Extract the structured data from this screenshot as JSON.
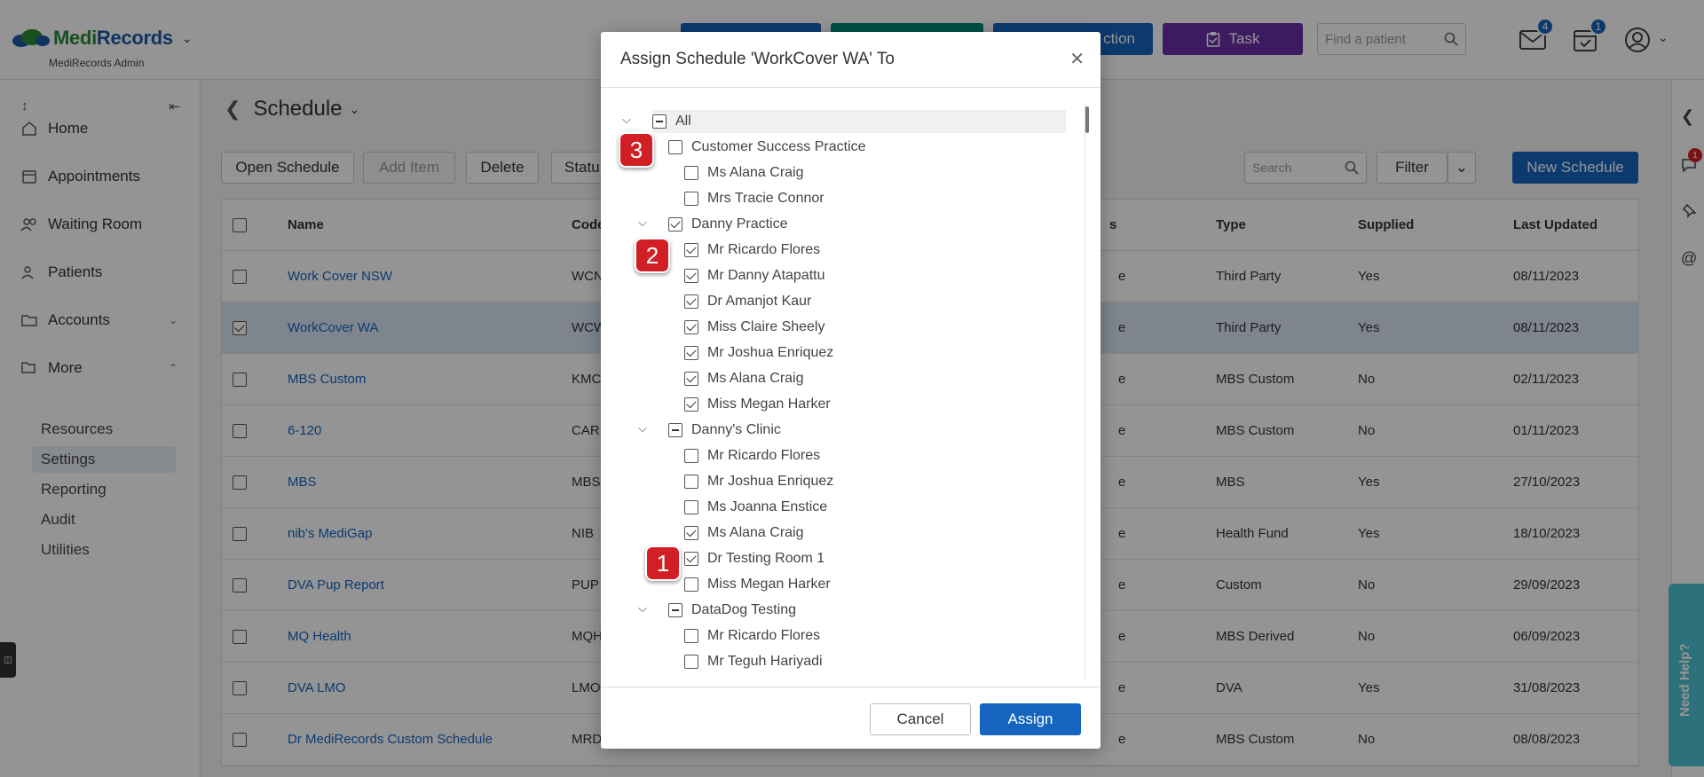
{
  "header": {
    "brand_medi": "Medi",
    "brand_records": "Records",
    "subtitle": "MediRecords Admin",
    "btn3_label": "ction",
    "task_label": "Task",
    "find_placeholder": "Find a patient",
    "messages_badge": "4",
    "tasks_badge": "1"
  },
  "sidebar": {
    "items": [
      {
        "label": "Home"
      },
      {
        "label": "Appointments"
      },
      {
        "label": "Waiting Room"
      },
      {
        "label": "Patients"
      },
      {
        "label": "Accounts"
      },
      {
        "label": "More"
      }
    ],
    "sub_items": [
      {
        "label": "Resources"
      },
      {
        "label": "Settings"
      },
      {
        "label": "Reporting"
      },
      {
        "label": "Audit"
      },
      {
        "label": "Utilities"
      }
    ]
  },
  "page": {
    "title": "Schedule",
    "toolbar": {
      "open": "Open Schedule",
      "add": "Add Item",
      "delete": "Delete",
      "status": "Statu",
      "search_placeholder": "Search",
      "filter": "Filter",
      "new": "New Schedule"
    },
    "columns": {
      "name": "Name",
      "code": "Code",
      "status": "s",
      "type": "Type",
      "supplied": "Supplied",
      "updated": "Last Updated"
    },
    "rows": [
      {
        "name": "Work Cover NSW",
        "code": "WCN",
        "status": "e",
        "type": "Third Party",
        "supplied": "Yes",
        "updated": "08/11/2023",
        "selected": false
      },
      {
        "name": "WorkCover WA",
        "code": "WCW",
        "status": "e",
        "type": "Third Party",
        "supplied": "Yes",
        "updated": "08/11/2023",
        "selected": true
      },
      {
        "name": "MBS Custom",
        "code": "KMC",
        "status": "e",
        "type": "MBS Custom",
        "supplied": "No",
        "updated": "02/11/2023",
        "selected": false
      },
      {
        "name": "6-120",
        "code": "CAR",
        "status": "e",
        "type": "MBS Custom",
        "supplied": "No",
        "updated": "01/11/2023",
        "selected": false
      },
      {
        "name": "MBS",
        "code": "MBS",
        "status": "e",
        "type": "MBS",
        "supplied": "Yes",
        "updated": "27/10/2023",
        "selected": false
      },
      {
        "name": "nib's MediGap",
        "code": "NIB",
        "status": "e",
        "type": "Health Fund",
        "supplied": "Yes",
        "updated": "18/10/2023",
        "selected": false
      },
      {
        "name": "DVA Pup Report",
        "code": "PUP",
        "status": "e",
        "type": "Custom",
        "supplied": "No",
        "updated": "29/09/2023",
        "selected": false
      },
      {
        "name": "MQ Health",
        "code": "MQH",
        "status": "e",
        "type": "MBS Derived",
        "supplied": "No",
        "updated": "06/09/2023",
        "selected": false
      },
      {
        "name": "DVA LMO",
        "code": "LMO",
        "status": "e",
        "type": "DVA",
        "supplied": "Yes",
        "updated": "31/08/2023",
        "selected": false
      },
      {
        "name": "Dr MediRecords Custom Schedule",
        "code": "MRD",
        "status": "e",
        "type": "MBS Custom",
        "supplied": "No",
        "updated": "08/08/2023",
        "selected": false
      }
    ]
  },
  "right_rail": {
    "chat_badge": "1",
    "need_help": "Need Help?"
  },
  "modal": {
    "title": "Assign Schedule 'WorkCover WA' To",
    "cancel": "Cancel",
    "assign": "Assign",
    "tree": [
      {
        "label": "All",
        "level": 0,
        "state": "ind",
        "expandable": true
      },
      {
        "label": "Customer Success Practice",
        "level": 1,
        "state": "off",
        "expandable": false
      },
      {
        "label": "Ms Alana Craig",
        "level": 2,
        "state": "off"
      },
      {
        "label": "Mrs Tracie Connor",
        "level": 2,
        "state": "off"
      },
      {
        "label": "Danny Practice",
        "level": 1,
        "state": "on",
        "expandable": true
      },
      {
        "label": "Mr Ricardo Flores",
        "level": 2,
        "state": "on"
      },
      {
        "label": "Mr Danny Atapattu",
        "level": 2,
        "state": "on"
      },
      {
        "label": "Dr Amanjot Kaur",
        "level": 2,
        "state": "on"
      },
      {
        "label": "Miss Claire Sheely",
        "level": 2,
        "state": "on"
      },
      {
        "label": "Mr Joshua Enriquez",
        "level": 2,
        "state": "on"
      },
      {
        "label": "Ms Alana Craig",
        "level": 2,
        "state": "on"
      },
      {
        "label": "Miss Megan Harker",
        "level": 2,
        "state": "on"
      },
      {
        "label": "Danny's Clinic",
        "level": 1,
        "state": "ind",
        "expandable": true
      },
      {
        "label": "Mr Ricardo Flores",
        "level": 2,
        "state": "off"
      },
      {
        "label": "Mr Joshua Enriquez",
        "level": 2,
        "state": "off"
      },
      {
        "label": "Ms Joanna Enstice",
        "level": 2,
        "state": "off"
      },
      {
        "label": "Ms Alana Craig",
        "level": 2,
        "state": "on"
      },
      {
        "label": "Dr Testing Room 1",
        "level": 2,
        "state": "on"
      },
      {
        "label": "Miss Megan Harker",
        "level": 2,
        "state": "off"
      },
      {
        "label": "DataDog Testing",
        "level": 1,
        "state": "ind",
        "expandable": true
      },
      {
        "label": "Mr Ricardo Flores",
        "level": 2,
        "state": "off"
      },
      {
        "label": "Mr Teguh Hariyadi",
        "level": 2,
        "state": "off"
      }
    ]
  },
  "callouts": [
    "3",
    "2",
    "1"
  ]
}
